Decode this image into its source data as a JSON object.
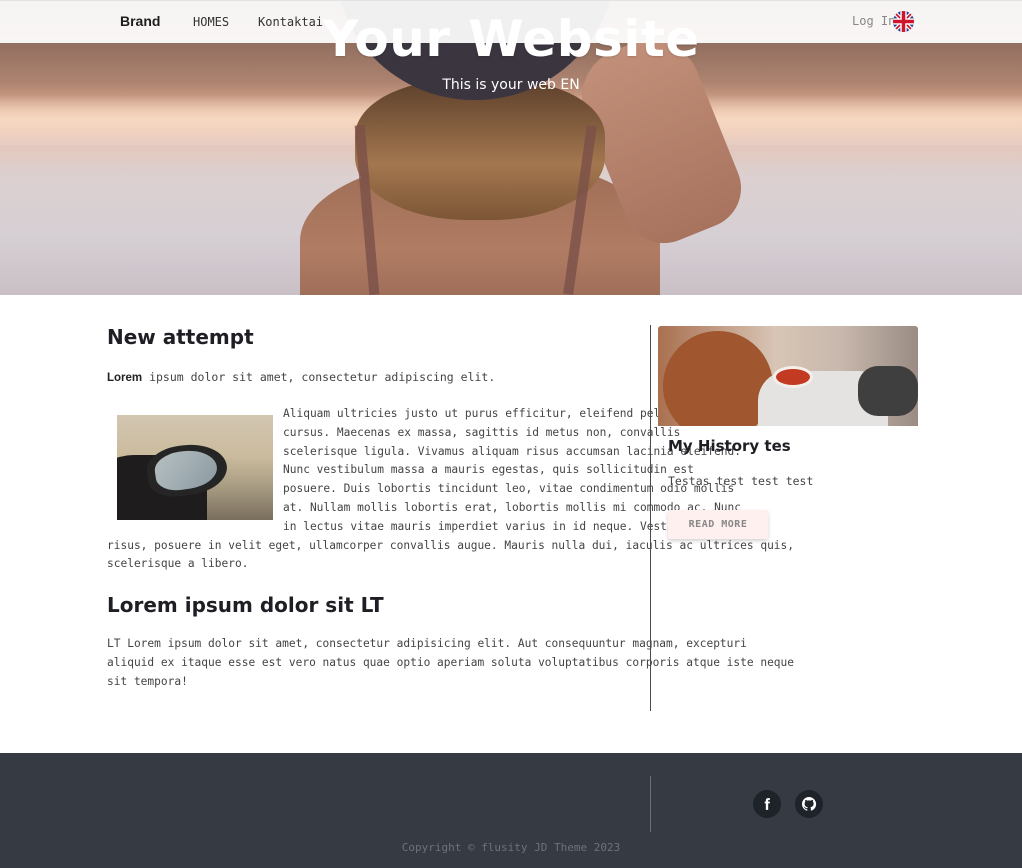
{
  "navbar": {
    "brand": "Brand",
    "links": [
      "HOMES",
      "Kontaktai"
    ],
    "login": "Log In",
    "language_flag": "uk-flag-icon"
  },
  "hero": {
    "title": "Your Website",
    "subtitle": "This is your web EN"
  },
  "article": {
    "title": "New attempt",
    "lead_bold": "Lorem",
    "lead_rest": " ipsum dolor sit amet, consectetur adipiscing elit.",
    "body_lines": [
      "Aliquam ultricies justo ut purus efficitur, eleifend pellentesque risus",
      "cursus. Maecenas ex massa, sagittis id metus non, convallis",
      "scelerisque ligula. Vivamus aliquam risus accumsan lacinia eleifend.",
      "Nunc vestibulum massa a mauris egestas, quis sollicitudin est",
      "posuere. Duis lobortis tincidunt leo, vitae condimentum odio mollis",
      "at. Nullam mollis lobortis erat, lobortis mollis mi commodo ac. Nunc",
      "in lectus vitae mauris imperdiet varius in id neque. Vestibulum orci",
      "risus, posuere in velit eget, ullamcorper convallis augue. Mauris nulla dui, iaculis ac ultrices quis,",
      "scelerisque a libero."
    ],
    "section2_title": "Lorem ipsum dolor sit LT",
    "section2_lines": [
      "LT Lorem ipsum dolor sit amet, consectetur adipisicing elit. Aut consequuntur magnam, excepturi",
      "aliquid ex itaque esse est vero natus quae optio aperiam soluta voluptatibus corporis atque iste neque",
      "sit tempora!"
    ]
  },
  "sidebar": {
    "card_title": "My History tes",
    "card_text": "Testas test test test",
    "button": "READ MORE"
  },
  "footer": {
    "social": [
      "facebook-icon",
      "github-icon"
    ],
    "copyright": "Copyright © flusity JD Theme 2023"
  }
}
